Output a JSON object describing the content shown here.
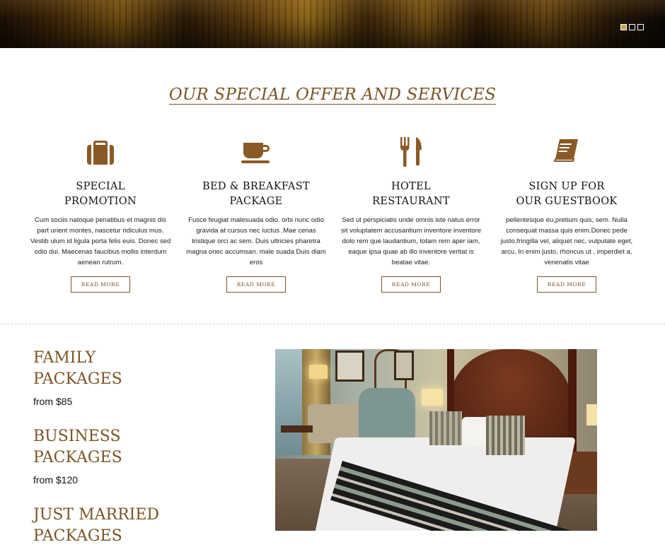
{
  "hero": {
    "slides": [
      true,
      false,
      false
    ]
  },
  "section": {
    "title": "OUR SPECIAL OFFER AND SERVICES"
  },
  "services": [
    {
      "icon": "briefcase-icon",
      "title_line1": "SPECIAL",
      "title_line2": "PROMOTION",
      "desc": "Cum sociis natoque penatibus et magnis dis part urient montes, nascetur ridiculus mus. Vestib ulum id ligula porta felis euis. Donec sed odio dui. Maecenas faucibus mollis interdum aenean rutrum.",
      "button": "READ MORE"
    },
    {
      "icon": "coffee-cup-icon",
      "title_line1": "BED & BREAKFAST",
      "title_line2": "PACKAGE",
      "desc": "Fusce feugiat malesuada odio. orbi nunc odio gravida at cursus nec luctus .Mae cenas tristique orci ac sem. Duis ultricies pharetra magna onec accumsan. male suada Duis diam eros",
      "button": "READ MORE"
    },
    {
      "icon": "fork-knife-icon",
      "title_line1": "HOTEL",
      "title_line2": "RESTAURANT",
      "desc": "Sed ut perspiciatis unde omnis iste natus error sit voluptatem accusantium inventore  inventore dolo rem que laudantium, totam rem aper iam, eaque ipsa quae ab illo inventore veritat is beatae vitae.",
      "button": "READ MORE"
    },
    {
      "icon": "book-icon",
      "title_line1": "SIGN UP FOR",
      "title_line2": "OUR GUESTBOOK",
      "desc": "pellentesque eu,pretium quis, sem. Nulla consequat massa quis enim.Donec pede justo,fringilla vel, aliquet nec, vulputate eget, arcu. In enim justo, rhoncus ut , imperdiet a, venenatis vitae",
      "button": "READ MORE"
    }
  ],
  "packages": [
    {
      "line1": "FAMILY",
      "line2": "PACKAGES",
      "price": "from $85"
    },
    {
      "line1": "BUSINESS",
      "line2": "PACKAGES",
      "price": "from $120"
    },
    {
      "line1": "JUST MARRIED",
      "line2": "PACKAGES",
      "price": ""
    }
  ],
  "colors": {
    "accent": "#7a5525",
    "icon": "#8a5a26"
  }
}
